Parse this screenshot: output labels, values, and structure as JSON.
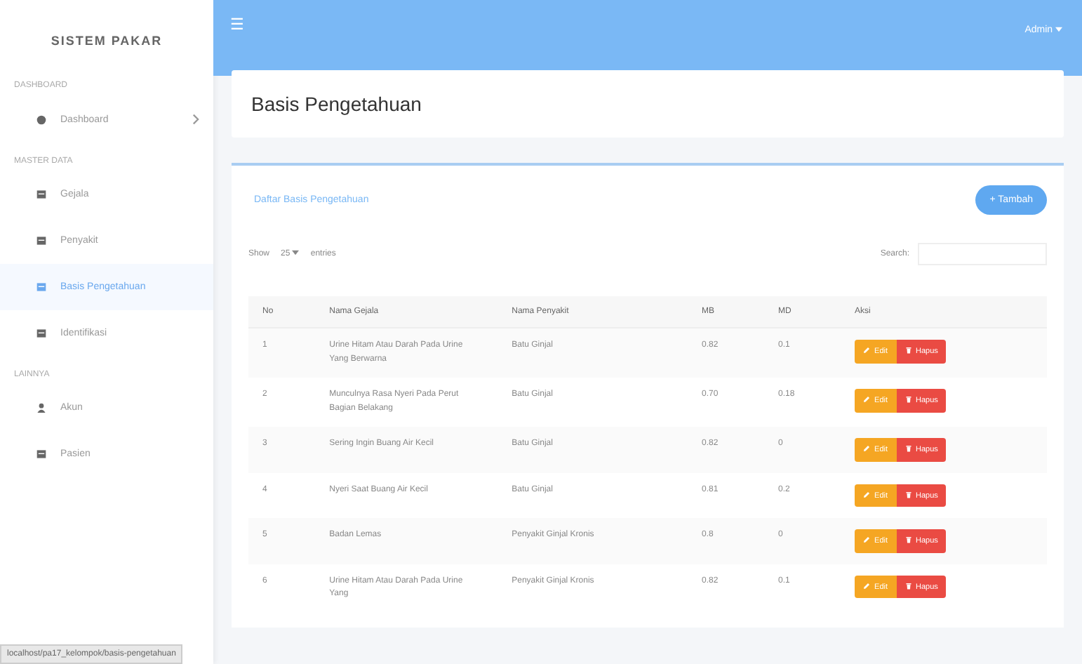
{
  "sidebar": {
    "brand": "SISTEM PAKAR",
    "sections": [
      {
        "heading": "DASHBOARD",
        "items": [
          {
            "label": "Dashboard",
            "kind": "gauge",
            "selected": false,
            "has_arrow": true
          }
        ]
      },
      {
        "heading": "MASTER DATA",
        "items": [
          {
            "label": "Gejala",
            "kind": "table",
            "selected": false,
            "has_arrow": false
          },
          {
            "label": "Penyakit",
            "kind": "table",
            "selected": false,
            "has_arrow": false
          },
          {
            "label": "Basis Pengetahuan",
            "kind": "table",
            "selected": true,
            "has_arrow": false
          },
          {
            "label": "Identifikasi",
            "kind": "table",
            "selected": false,
            "has_arrow": false
          }
        ]
      },
      {
        "heading": "LAINNYA",
        "items": [
          {
            "label": "Akun",
            "kind": "user",
            "selected": false,
            "has_arrow": false
          },
          {
            "label": "Pasien",
            "kind": "table",
            "selected": false,
            "has_arrow": false
          }
        ]
      }
    ]
  },
  "topbar": {
    "menu_glyph": "☰",
    "user": "Admin"
  },
  "page_title": "Basis Pengetahuan",
  "card": {
    "title": "Daftar Basis Pengetahuan",
    "add_button": "+ Tambah",
    "show_label": "Show",
    "page_size": "25",
    "entries_label": "entries",
    "search_label": "Search:"
  },
  "table": {
    "columns": [
      "No",
      "Nama Gejala",
      "Nama Penyakit",
      "MB",
      "MD",
      "Aksi"
    ],
    "rows": [
      {
        "no": "1",
        "gejala": "Urine Hitam Atau Darah Pada Urine Yang Berwarna",
        "penyakit": "Batu Ginjal",
        "mb": "0.82",
        "md": "0.1",
        "edit": "Edit",
        "delete": "Hapus"
      },
      {
        "no": "2",
        "gejala": "Munculnya Rasa Nyeri Pada Perut Bagian Belakang",
        "penyakit": "Batu Ginjal",
        "mb": "0.70",
        "md": "0.18",
        "edit": "Edit",
        "delete": "Hapus"
      },
      {
        "no": "3",
        "gejala": "Sering Ingin Buang Air Kecil",
        "penyakit": "Batu Ginjal",
        "mb": "0.82",
        "md": "0",
        "edit": "Edit",
        "delete": "Hapus"
      },
      {
        "no": "4",
        "gejala": "Nyeri Saat Buang Air Kecil",
        "penyakit": "Batu Ginjal",
        "mb": "0.81",
        "md": "0.2",
        "edit": "Edit",
        "delete": "Hapus"
      },
      {
        "no": "5",
        "gejala": "Badan Lemas",
        "penyakit": "Penyakit Ginjal Kronis",
        "mb": "0.8",
        "md": "0",
        "edit": "Edit",
        "delete": "Hapus"
      },
      {
        "no": "6",
        "gejala": "Urine Hitam Atau Darah Pada Urine Yang",
        "penyakit": "Penyakit Ginjal Kronis",
        "mb": "0.82",
        "md": "0.1",
        "edit": "Edit",
        "delete": "Hapus"
      }
    ]
  },
  "status_bar": "localhost/pa17_kelompok/basis-pengetahuan"
}
